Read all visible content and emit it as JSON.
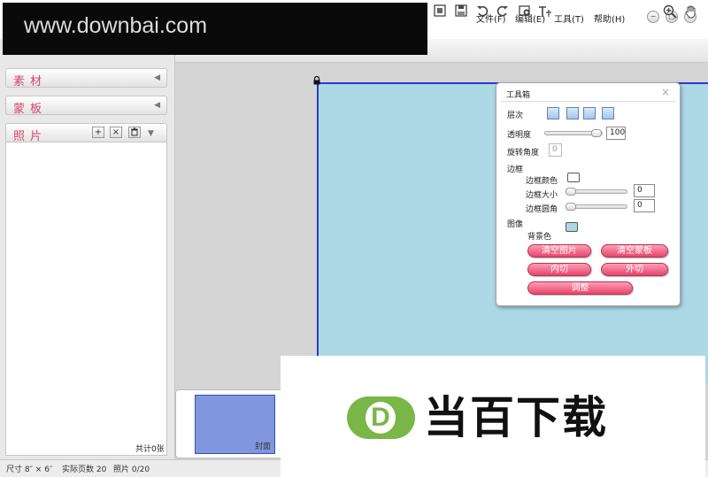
{
  "watermark_text": "www.downbai.com",
  "menu": {
    "file": "文件(F)",
    "edit": "编辑(E)",
    "tools": "工具(T)",
    "help": "帮助(H)"
  },
  "window_controls": {
    "minimize": "−",
    "maximize": "□",
    "close": "×"
  },
  "left_panel": {
    "sections": [
      {
        "title": "素材"
      },
      {
        "title": "蒙板"
      },
      {
        "title": "照片"
      }
    ],
    "photo_total": "共计0张"
  },
  "toolbox": {
    "title": "工具箱",
    "layer_label": "层次",
    "opacity_label": "透明度",
    "opacity_value": "100",
    "opacity": 1.0,
    "rotation_label": "旋转角度",
    "rotation_value": "0",
    "border_label": "边框",
    "border_color_label": "边框颜色",
    "border_size_label": "边框大小",
    "border_size_value": "0",
    "border_radius_label": "边框圆角",
    "border_radius_value": "0",
    "image_label": "图像",
    "bg_color_label": "背景色",
    "bg_color": "#add8e6",
    "buttons": {
      "clear_photo": "清空图片",
      "clear_mask": "清空蒙板",
      "inner_cut": "内切",
      "outer_cut": "外切",
      "adjust": "调整"
    }
  },
  "filmstrip": {
    "cover_label": "封面"
  },
  "status": {
    "size": "尺寸 8″ × 6″",
    "pages": "实际页数 20",
    "photos": "照片 0/20"
  },
  "overlay_logo": {
    "letter": "D",
    "text": "当百下载"
  },
  "colors": {
    "accent_pink": "#d2476e",
    "canvas_blue": "#add8e6",
    "selection_blue": "#2a39c8",
    "logo_green": "#7ab648"
  }
}
